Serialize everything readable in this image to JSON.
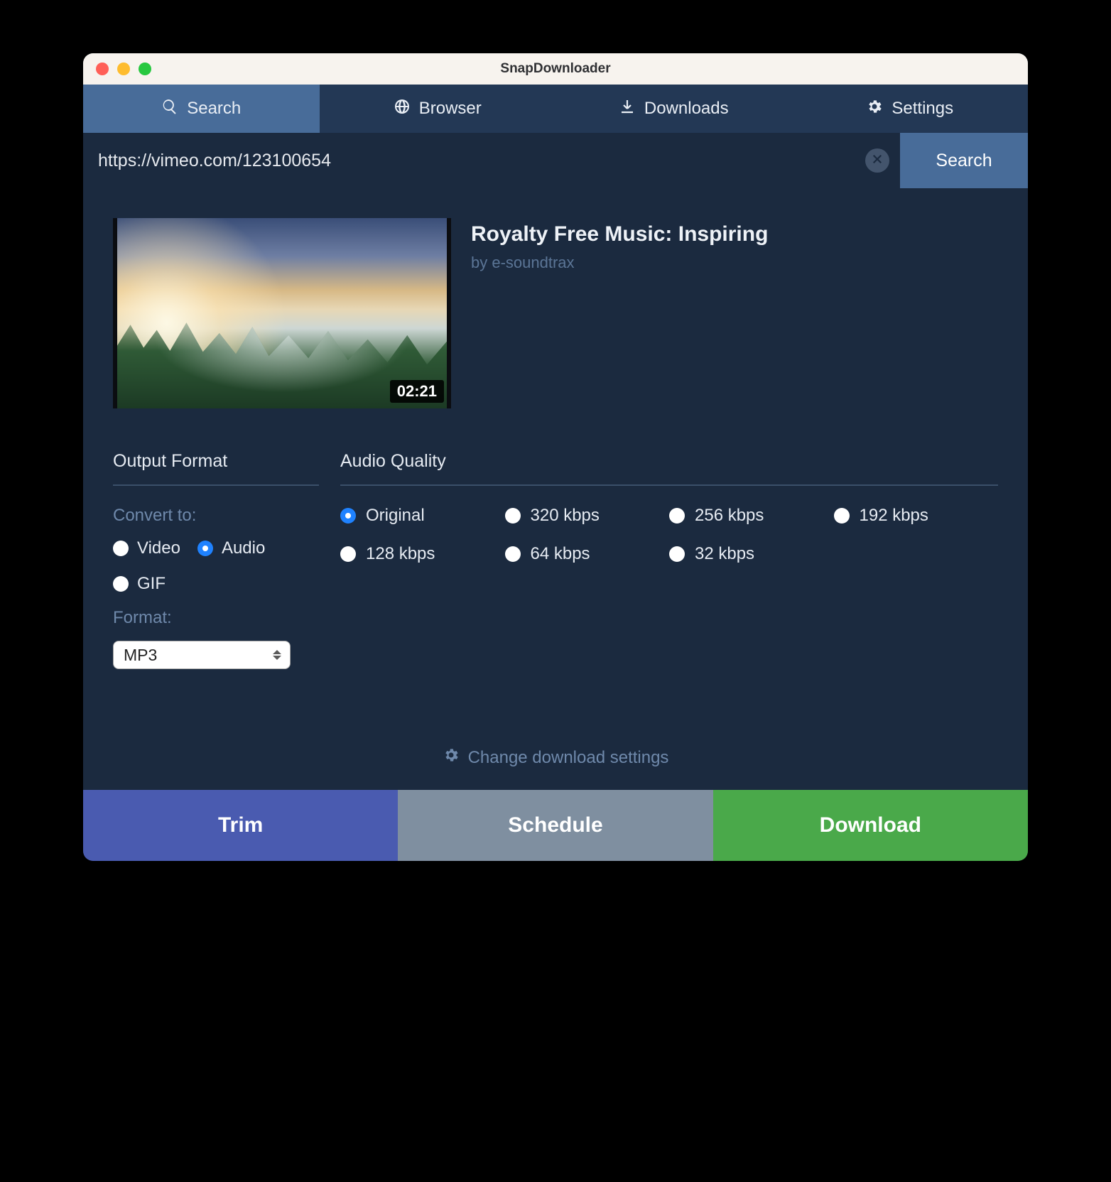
{
  "window": {
    "title": "SnapDownloader"
  },
  "tabs": {
    "search": "Search",
    "browser": "Browser",
    "downloads": "Downloads",
    "settings": "Settings",
    "active": "search"
  },
  "searchbar": {
    "value": "https://vimeo.com/123100654",
    "button": "Search"
  },
  "video": {
    "title": "Royalty Free Music: Inspiring",
    "author": "by e-soundtrax",
    "duration": "02:21"
  },
  "output_format": {
    "heading": "Output Format",
    "convert_to_label": "Convert to:",
    "options": [
      "Video",
      "Audio",
      "GIF"
    ],
    "selected": "Audio",
    "format_label": "Format:",
    "format_value": "MP3"
  },
  "audio_quality": {
    "heading": "Audio Quality",
    "options": [
      "Original",
      "320 kbps",
      "256 kbps",
      "192 kbps",
      "128 kbps",
      "64 kbps",
      "32 kbps"
    ],
    "selected": "Original"
  },
  "change_settings": "Change download settings",
  "actions": {
    "trim": "Trim",
    "schedule": "Schedule",
    "download": "Download"
  }
}
